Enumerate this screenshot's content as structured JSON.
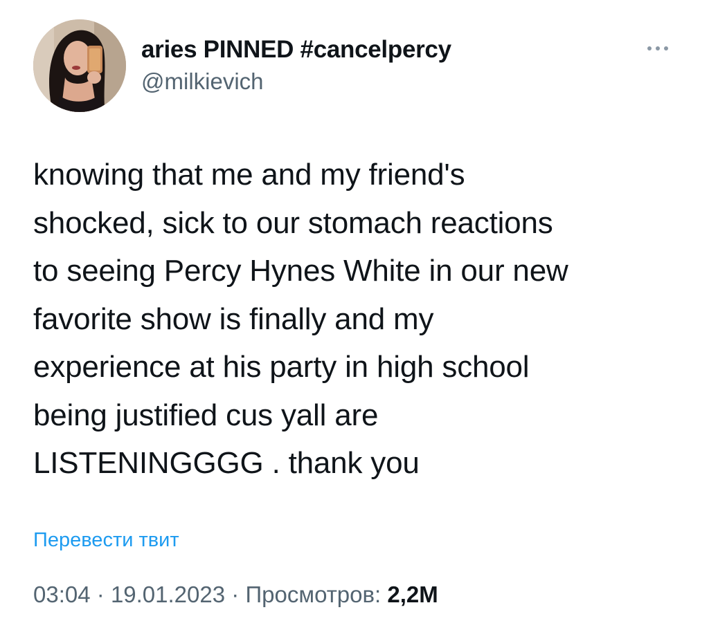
{
  "tweet": {
    "author": {
      "display_name": "aries PINNED #cancelpercy",
      "handle": "@milkievich"
    },
    "more_icon": "more-horizontal-icon",
    "text_lines": [
      "knowing that me and my friend's",
      "shocked, sick to our stomach reactions",
      "to seeing Percy Hynes White in our new",
      "favorite show is finally and my",
      "experience at his party in high school",
      "being justified cus yall are",
      "LISTENINGGGG . thank you"
    ],
    "translate_label": "Перевести твит",
    "time": "03:04",
    "date": "19.01.2023",
    "separator": "·",
    "views_label": "Просмотров:",
    "views_count": "2,2M"
  },
  "colors": {
    "text_primary": "#0f1419",
    "text_secondary": "#536471",
    "link": "#1d9bf0",
    "background": "#ffffff"
  }
}
